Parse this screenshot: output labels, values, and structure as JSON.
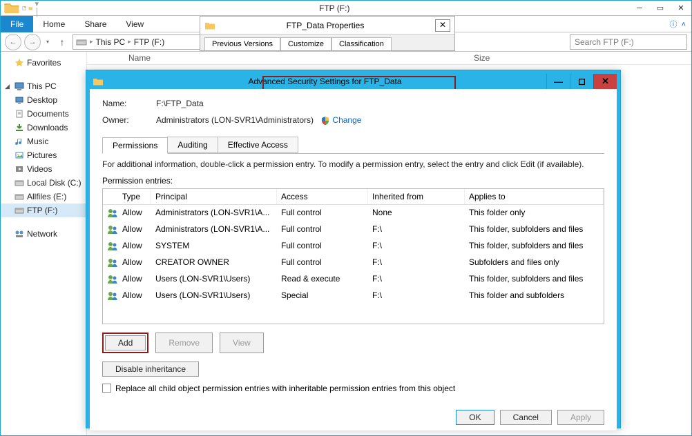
{
  "explorer": {
    "title": "FTP (F:)",
    "ribbon": {
      "file": "File",
      "tabs": [
        "Home",
        "Share",
        "View"
      ]
    },
    "address": {
      "segments": [
        "This PC",
        "FTP (F:)"
      ]
    },
    "search_placeholder": "Search FTP (F:)",
    "list_head": {
      "name": "Name",
      "size": "Size"
    },
    "sidebar": {
      "favorites": "Favorites",
      "this_pc": "This PC",
      "items": [
        {
          "label": "Desktop"
        },
        {
          "label": "Documents"
        },
        {
          "label": "Downloads"
        },
        {
          "label": "Music"
        },
        {
          "label": "Pictures"
        },
        {
          "label": "Videos"
        },
        {
          "label": "Local Disk (C:)"
        },
        {
          "label": "Allfiles (E:)"
        },
        {
          "label": "FTP (F:)",
          "selected": true
        }
      ],
      "network": "Network"
    }
  },
  "props": {
    "title": "FTP_Data Properties",
    "tabs": [
      "Previous Versions",
      "Customize",
      "Classification"
    ]
  },
  "adv": {
    "title": "Advanced Security Settings for FTP_Data",
    "name_label": "Name:",
    "name_value": "F:\\FTP_Data",
    "owner_label": "Owner:",
    "owner_value": "Administrators (LON-SVR1\\Administrators)",
    "change": "Change",
    "tabs": [
      "Permissions",
      "Auditing",
      "Effective Access"
    ],
    "instructions": "For additional information, double-click a permission entry. To modify a permission entry, select the entry and click Edit (if available).",
    "perm_label": "Permission entries:",
    "columns": {
      "type": "Type",
      "principal": "Principal",
      "access": "Access",
      "inherited": "Inherited from",
      "applies": "Applies to"
    },
    "rows": [
      {
        "type": "Allow",
        "principal": "Administrators (LON-SVR1\\A...",
        "access": "Full control",
        "inherited": "None",
        "applies": "This folder only"
      },
      {
        "type": "Allow",
        "principal": "Administrators (LON-SVR1\\A...",
        "access": "Full control",
        "inherited": "F:\\",
        "applies": "This folder, subfolders and files"
      },
      {
        "type": "Allow",
        "principal": "SYSTEM",
        "access": "Full control",
        "inherited": "F:\\",
        "applies": "This folder, subfolders and files"
      },
      {
        "type": "Allow",
        "principal": "CREATOR OWNER",
        "access": "Full control",
        "inherited": "F:\\",
        "applies": "Subfolders and files only"
      },
      {
        "type": "Allow",
        "principal": "Users (LON-SVR1\\Users)",
        "access": "Read & execute",
        "inherited": "F:\\",
        "applies": "This folder, subfolders and files"
      },
      {
        "type": "Allow",
        "principal": "Users (LON-SVR1\\Users)",
        "access": "Special",
        "inherited": "F:\\",
        "applies": "This folder and subfolders"
      }
    ],
    "buttons": {
      "add": "Add",
      "remove": "Remove",
      "view": "View",
      "disable": "Disable inheritance"
    },
    "checkbox": "Replace all child object permission entries with inheritable permission entries from this object",
    "dlg": {
      "ok": "OK",
      "cancel": "Cancel",
      "apply": "Apply"
    }
  }
}
